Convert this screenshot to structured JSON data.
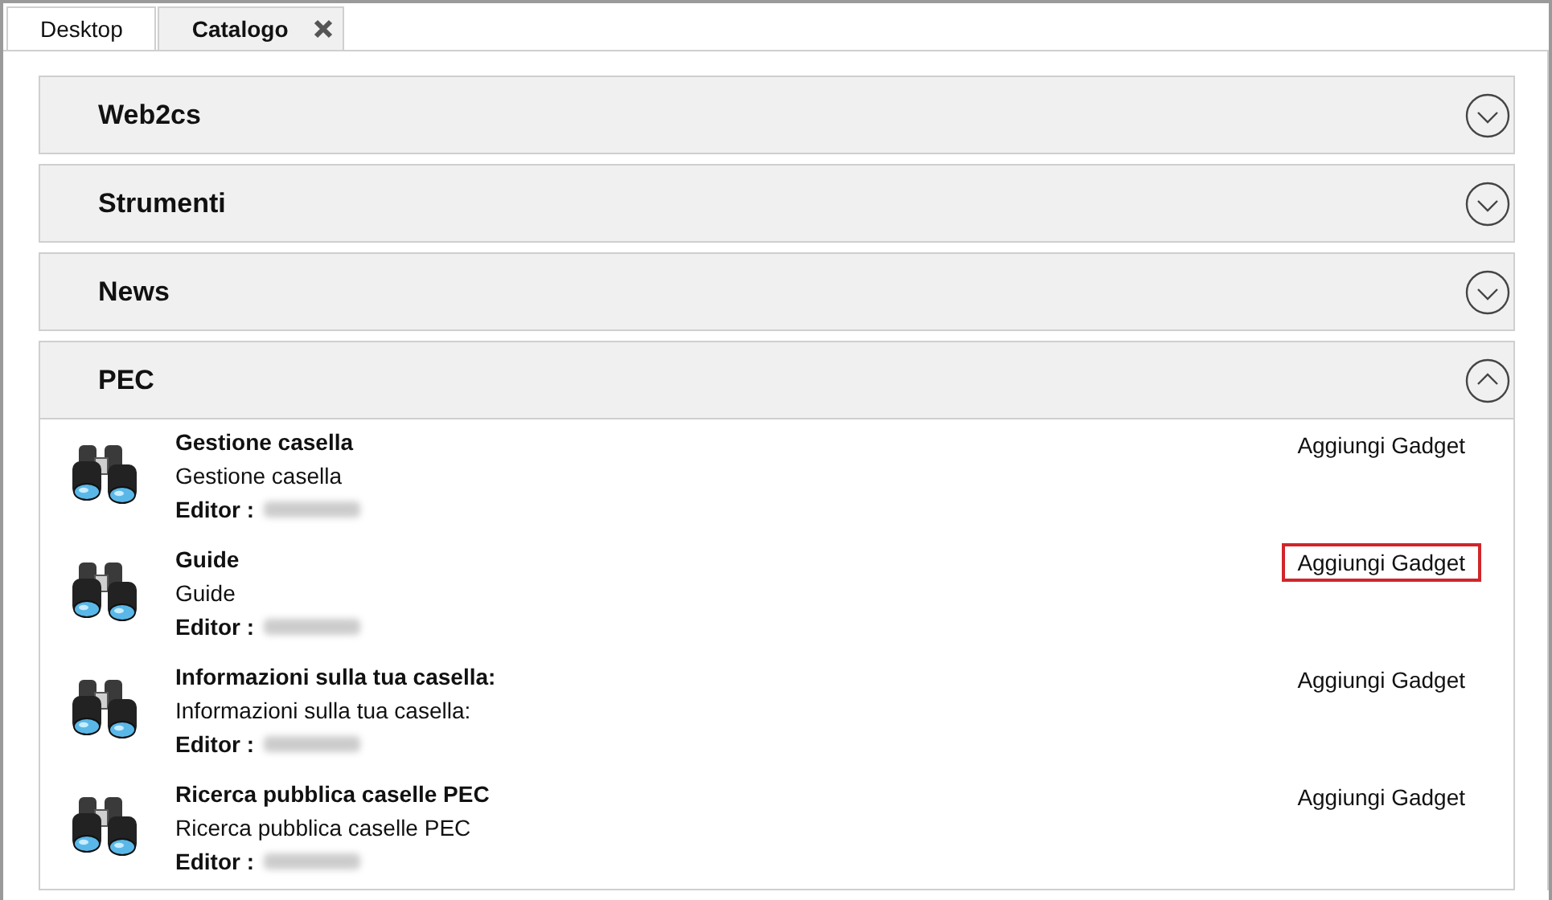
{
  "tabs": [
    {
      "label": "Desktop",
      "selected": false,
      "closable": false
    },
    {
      "label": "Catalogo",
      "selected": true,
      "closable": true
    }
  ],
  "sections": [
    {
      "title": "Web2cs",
      "expanded": false
    },
    {
      "title": "Strumenti",
      "expanded": false
    },
    {
      "title": "News",
      "expanded": false
    },
    {
      "title": "PEC",
      "expanded": true,
      "items": [
        {
          "title": "Gestione casella",
          "description": "Gestione casella",
          "editor_label": "Editor :",
          "action": "Aggiungi Gadget",
          "highlighted": false
        },
        {
          "title": "Guide",
          "description": "Guide",
          "editor_label": "Editor :",
          "action": "Aggiungi Gadget",
          "highlighted": true
        },
        {
          "title": "Informazioni sulla tua casella:",
          "description": "Informazioni sulla tua casella:",
          "editor_label": "Editor :",
          "action": "Aggiungi Gadget",
          "highlighted": false
        },
        {
          "title": "Ricerca pubblica caselle PEC",
          "description": "Ricerca pubblica caselle PEC",
          "editor_label": "Editor :",
          "action": "Aggiungi Gadget",
          "highlighted": false
        }
      ]
    }
  ]
}
